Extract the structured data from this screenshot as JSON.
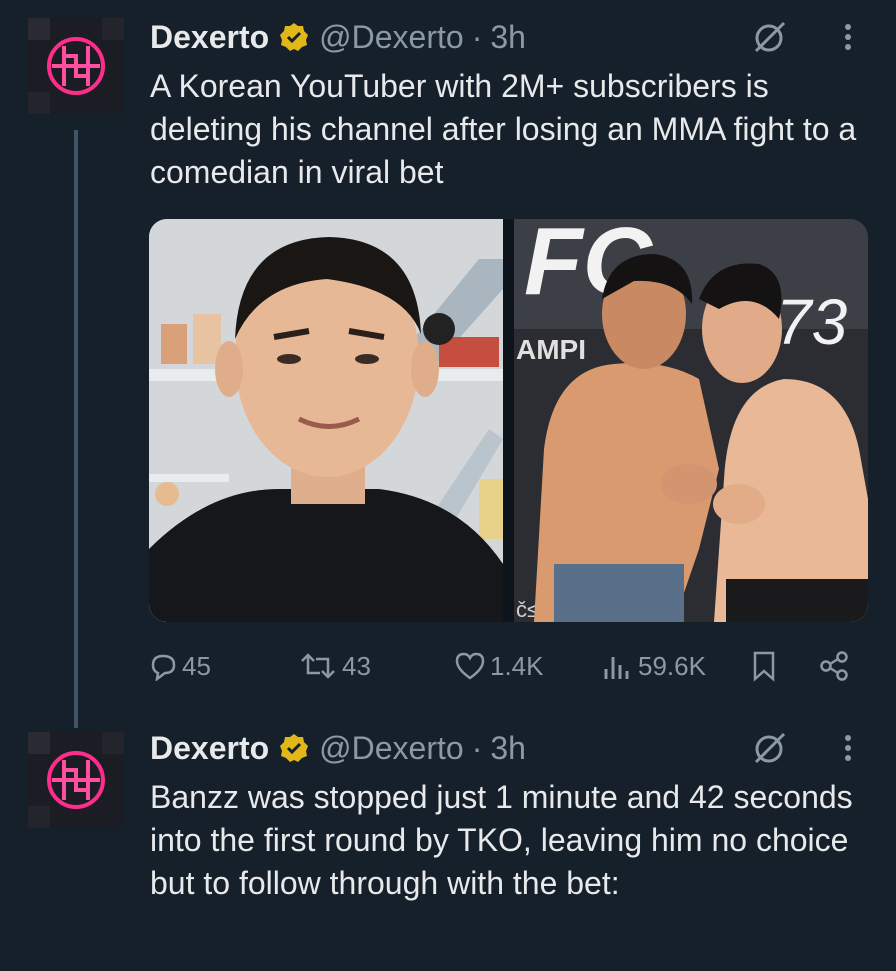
{
  "tweets": [
    {
      "author": "Dexerto",
      "handle": "@Dexerto",
      "sep": "·",
      "time": "3h",
      "text": "A Korean YouTuber with 2M+ subscribers is deleting his channel after losing an MMA fight to a comedian in viral bet",
      "media": {
        "images": [
          {
            "icon": "youtuber-selfie-photo"
          },
          {
            "icon": "mma-faceoff-photo",
            "overlay_text": [
              "FC",
              "73",
              "AMPI",
              "č≤"
            ]
          }
        ]
      },
      "actions": {
        "replies": "45",
        "reposts": "43",
        "likes": "1.4K",
        "views": "59.6K"
      }
    },
    {
      "author": "Dexerto",
      "handle": "@Dexerto",
      "sep": "·",
      "time": "3h",
      "text": "Banzz was stopped just 1 minute and 42 seconds into the first round by TKO, leaving him no choice but to follow through with the bet:"
    }
  ],
  "colors": {
    "background": "#15202b",
    "text": "#e7e9ea",
    "muted": "#8b98a5",
    "verified_gold": "#e2b719",
    "neon_pink": "#ff2d8a"
  }
}
